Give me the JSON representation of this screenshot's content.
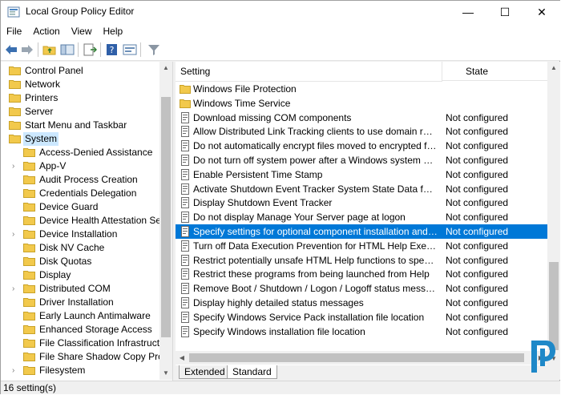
{
  "window": {
    "title": "Local Group Policy Editor",
    "controls": {
      "minimize": "—",
      "maximize": "☐",
      "close": "✕"
    }
  },
  "menu": [
    "File",
    "Action",
    "View",
    "Help"
  ],
  "tree": {
    "items": [
      {
        "label": "Control Panel",
        "level": 0,
        "expandable": false
      },
      {
        "label": "Network",
        "level": 0,
        "expandable": false
      },
      {
        "label": "Printers",
        "level": 0,
        "expandable": false
      },
      {
        "label": "Server",
        "level": 0,
        "expandable": false
      },
      {
        "label": "Start Menu and Taskbar",
        "level": 0,
        "expandable": false
      },
      {
        "label": "System",
        "level": 0,
        "expandable": true,
        "expanded": true,
        "selected": true
      },
      {
        "label": "Access-Denied Assistance",
        "level": 1,
        "expandable": false
      },
      {
        "label": "App-V",
        "level": 1,
        "expandable": true
      },
      {
        "label": "Audit Process Creation",
        "level": 1,
        "expandable": false
      },
      {
        "label": "Credentials Delegation",
        "level": 1,
        "expandable": false
      },
      {
        "label": "Device Guard",
        "level": 1,
        "expandable": false
      },
      {
        "label": "Device Health Attestation Serv",
        "level": 1,
        "expandable": false
      },
      {
        "label": "Device Installation",
        "level": 1,
        "expandable": true
      },
      {
        "label": "Disk NV Cache",
        "level": 1,
        "expandable": false
      },
      {
        "label": "Disk Quotas",
        "level": 1,
        "expandable": false
      },
      {
        "label": "Display",
        "level": 1,
        "expandable": false
      },
      {
        "label": "Distributed COM",
        "level": 1,
        "expandable": true
      },
      {
        "label": "Driver Installation",
        "level": 1,
        "expandable": false
      },
      {
        "label": "Early Launch Antimalware",
        "level": 1,
        "expandable": false
      },
      {
        "label": "Enhanced Storage Access",
        "level": 1,
        "expandable": false
      },
      {
        "label": "File Classification Infrastructur",
        "level": 1,
        "expandable": false
      },
      {
        "label": "File Share Shadow Copy Provic",
        "level": 1,
        "expandable": false
      },
      {
        "label": "Filesystem",
        "level": 1,
        "expandable": true
      }
    ]
  },
  "list": {
    "columns": {
      "setting": "Setting",
      "state": "State"
    },
    "rows": [
      {
        "type": "folder",
        "name": "Windows File Protection",
        "state": ""
      },
      {
        "type": "folder",
        "name": "Windows Time Service",
        "state": ""
      },
      {
        "type": "policy",
        "name": "Download missing COM components",
        "state": "Not configured"
      },
      {
        "type": "policy",
        "name": "Allow Distributed Link Tracking clients to use domain resour...",
        "state": "Not configured"
      },
      {
        "type": "policy",
        "name": "Do not automatically encrypt files moved to encrypted fold...",
        "state": "Not configured"
      },
      {
        "type": "policy",
        "name": "Do not turn off system power after a Windows system shutd...",
        "state": "Not configured"
      },
      {
        "type": "policy",
        "name": "Enable Persistent Time Stamp",
        "state": "Not configured"
      },
      {
        "type": "policy",
        "name": "Activate Shutdown Event Tracker System State Data feature",
        "state": "Not configured"
      },
      {
        "type": "policy",
        "name": "Display Shutdown Event Tracker",
        "state": "Not configured"
      },
      {
        "type": "policy",
        "name": "Do not display Manage Your Server page at logon",
        "state": "Not configured"
      },
      {
        "type": "policy",
        "name": "Specify settings for optional component installation and co...",
        "state": "Not configured",
        "selected": true
      },
      {
        "type": "policy",
        "name": "Turn off Data Execution Prevention for HTML Help Executible",
        "state": "Not configured"
      },
      {
        "type": "policy",
        "name": "Restrict potentially unsafe HTML Help functions to specified...",
        "state": "Not configured"
      },
      {
        "type": "policy",
        "name": "Restrict these programs from being launched from Help",
        "state": "Not configured"
      },
      {
        "type": "policy",
        "name": "Remove Boot / Shutdown / Logon / Logoff status messages",
        "state": "Not configured"
      },
      {
        "type": "policy",
        "name": "Display highly detailed status messages",
        "state": "Not configured"
      },
      {
        "type": "policy",
        "name": "Specify Windows Service Pack installation file location",
        "state": "Not configured"
      },
      {
        "type": "policy",
        "name": "Specify Windows installation file location",
        "state": "Not configured"
      }
    ]
  },
  "tabs": [
    {
      "label": "Extended",
      "active": false
    },
    {
      "label": "Standard",
      "active": true
    }
  ],
  "status": {
    "text": "16 setting(s)"
  },
  "colors": {
    "selection": "#0078d7",
    "tree_selection": "#cce8ff",
    "folder": "#f2c94c",
    "logo": "#1e88c8"
  }
}
